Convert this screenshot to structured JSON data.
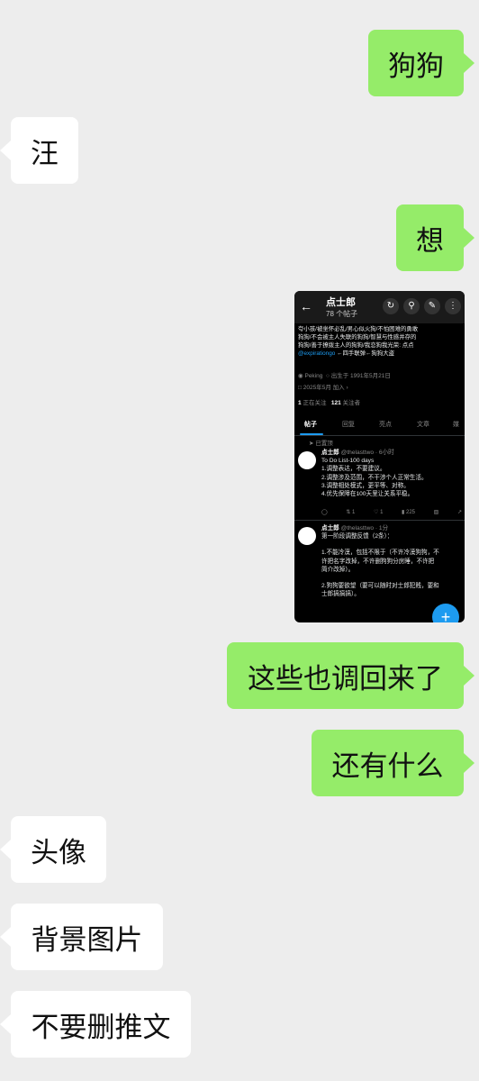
{
  "messages": [
    {
      "side": "right",
      "text": "狗狗"
    },
    {
      "side": "left",
      "text": "汪"
    },
    {
      "side": "right",
      "text": "想"
    },
    {
      "side": "right",
      "text": "这些也调回来了"
    },
    {
      "side": "right",
      "text": "还有什么"
    },
    {
      "side": "left",
      "text": "头像"
    },
    {
      "side": "left",
      "text": "背景图片"
    },
    {
      "side": "left",
      "text": "不要删推文"
    }
  ],
  "screenshot": {
    "profile_name": "点士郎",
    "post_count": "78 个帖子",
    "bio_lines": [
      "夸小孩/被坐怀必乱/男心似火狗/不怕困难的勇敢",
      "狗狗/不会被主人失联的狗狗/智慧与性感并存的",
      "狗狗/善于撩拨主人的狗狗/我恋狗我光荣: 点点"
    ],
    "bio_handle": "@expirationgo",
    "bio_tail": " ←四手联弹←狗狗大盗",
    "location": "Peking",
    "birthday": "出生于 1991年5月21日",
    "joined": "2025年5月 加入",
    "following_count": "1",
    "following_label": "正在关注",
    "followers_count": "121",
    "followers_label": "关注者",
    "tabs": [
      "帖子",
      "回复",
      "亮点",
      "文章",
      "媒"
    ],
    "pinned_label": "已置顶",
    "tweets": [
      {
        "author": "点士郎",
        "handle": "@thelasttwo · 6小时",
        "lines": [
          "To Do List-100 days",
          "1.调整表达，不要建议。",
          "2.调整涉及范围，不干涉个人正常生活。",
          "3.调整相处模式，更平等、对称。",
          "4.优先保障在100天里让关系平稳。"
        ],
        "stats": [
          "",
          "1",
          "1",
          "225",
          ""
        ]
      },
      {
        "author": "点士郎",
        "handle": "@thelasttwo · 1分",
        "lines": [
          "第一阶段调整反馈（2条）：",
          "",
          "1.不能冷漠，包括不限于（不许冷漠狗狗，不",
          "许把名字改掉，不许删狗狗分房睡，不许把",
          "简介改掉）。",
          "",
          "2.狗狗要欲望（要可以随时对士郎犯贱，要和",
          "士郎搞搞搞）。"
        ]
      }
    ],
    "fab_symbol": "+"
  }
}
